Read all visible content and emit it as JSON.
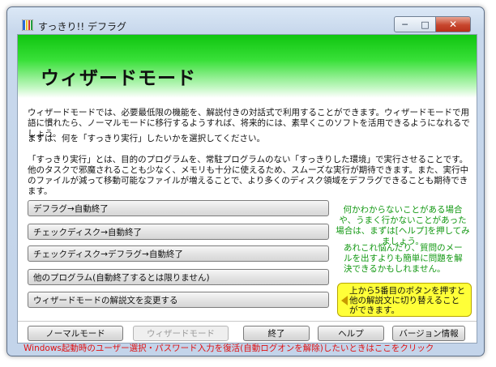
{
  "window": {
    "title": "すっきり!! デフラグ",
    "icon_name": "app-icon",
    "minimize_label": "─",
    "maximize_label": "□",
    "close_label": "✕"
  },
  "banner": {
    "title": "ウィザードモード"
  },
  "intro": {
    "paragraph1": "ウィザードモードでは、必要最低限の機能を、解説付きの対話式で利用することができます。ウィザードモードで用語に慣れたら、ノーマルモードに移行するようすれば、将来的には、素早くこのソフトを活用できるようになれるでしょう。",
    "paragraph2": "まずは、何を「すっきり実行」したいかを選択してください。",
    "paragraph3": "「すっきり実行」とは、目的のプログラムを、常駐プログラムのない「すっきりした環境」で実行させることです。他のタスクで邪魔されることも少なく、メモリも十分に使えるため、スムーズな実行が期待できます。また、実行中のファイルが減って移動可能なファイルが増えることで、より多くのディスク領域をデフラグできることも期待できます。"
  },
  "wizard_buttons": [
    "デフラグ→自動終了",
    "チェックディスク→自動終了",
    "チェックディスク→デフラグ→自動終了",
    "他のプログラム(自動終了するとは限りません)",
    "ウィザードモードの解説文を変更する"
  ],
  "hints": {
    "hint1": "何かわからないことがある場合や、うまく行かないことがあった場合は、まずは[ヘルプ]を押してみましょう。",
    "hint2": "あれこれ悩んだり、質問のメールを出すよりも簡単に問題を解決できるかもしれません。",
    "callout": "上から5番目のボタンを押すと他の解説文に切り替えることができます。"
  },
  "footer": {
    "normal_mode": "ノーマルモード",
    "wizard_mode": "ウィザードモード",
    "exit": "終了",
    "help": "ヘルプ",
    "version_info": "バージョン情報"
  },
  "status": {
    "text": "Windows起動時のユーザー選択・パスワード入力を復活(自動ログオンを解除)したいときはここをクリック"
  },
  "colors": {
    "banner_green": "#10c510",
    "hint_green": "#129812",
    "callout_yellow": "#ffff38",
    "status_red": "#e01010"
  }
}
